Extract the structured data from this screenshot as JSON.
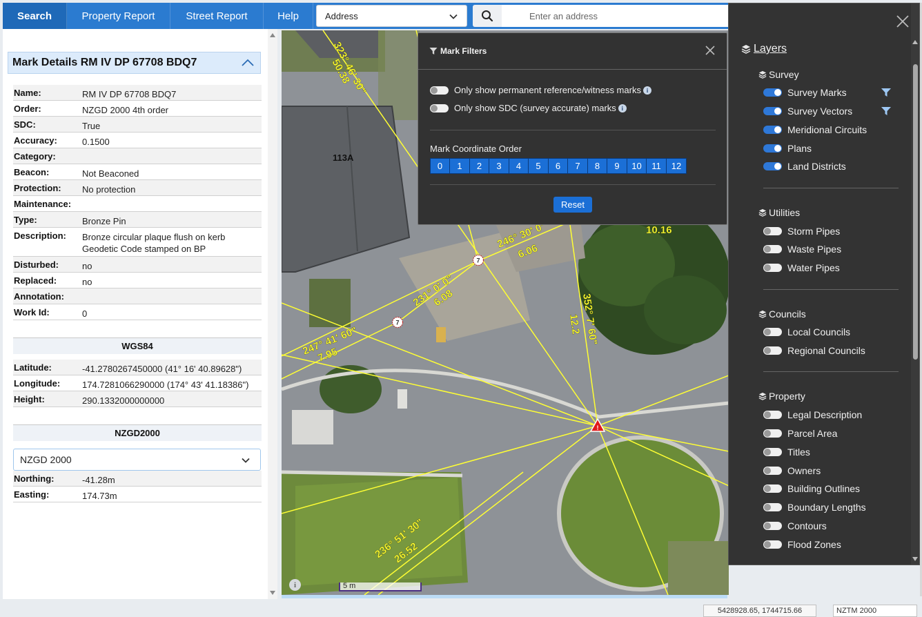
{
  "nav": {
    "search": "Search",
    "property_report": "Property Report",
    "street_report": "Street Report",
    "help": "Help"
  },
  "search": {
    "type_selected": "Address",
    "placeholder": "Enter an address"
  },
  "details": {
    "title": "Mark Details RM IV DP 67708 BDQ7",
    "rows": [
      {
        "label": "Name:",
        "value": "RM IV DP 67708 BDQ7"
      },
      {
        "label": "Order:",
        "value": "NZGD 2000 4th order"
      },
      {
        "label": "SDC:",
        "value": "True"
      },
      {
        "label": "Accuracy:",
        "value": "0.1500"
      },
      {
        "label": "Category:",
        "value": ""
      },
      {
        "label": "Beacon:",
        "value": "Not Beaconed"
      },
      {
        "label": "Protection:",
        "value": "No protection"
      },
      {
        "label": "Maintenance:",
        "value": ""
      },
      {
        "label": "Type:",
        "value": "Bronze Pin"
      },
      {
        "label": "Description:",
        "value": "Bronze circular plaque flush on kerb",
        "value2": "Geodetic Code stamped on BP"
      },
      {
        "label": "Disturbed:",
        "value": "no"
      },
      {
        "label": "Replaced:",
        "value": "no"
      },
      {
        "label": "Annotation:",
        "value": ""
      },
      {
        "label": "Work Id:",
        "value": "0"
      }
    ],
    "wgs84": {
      "heading": "WGS84",
      "rows": [
        {
          "label": "Latitude:",
          "value": "-41.2780267450000 (41° 16' 40.89628\")"
        },
        {
          "label": "Longitude:",
          "value": "174.7281066290000 (174° 43' 41.18386\")"
        },
        {
          "label": "Height:",
          "value": "290.1332000000000"
        }
      ]
    },
    "nzgd2000": {
      "heading": "NZGD2000",
      "datum_selected": "NZGD 2000",
      "rows": [
        {
          "label": "Northing:",
          "value": "-41.28m"
        },
        {
          "label": "Easting:",
          "value": "174.73m"
        }
      ]
    }
  },
  "map": {
    "building_label": "113A",
    "mark_label": "7",
    "scale_label": "5 m",
    "info_glyph": "i",
    "bearings": [
      {
        "angle": "323° 46' 30\"",
        "dist": "50.38"
      },
      {
        "angle": "246° 30' 0\"",
        "dist": "6.06"
      },
      {
        "angle": "231° 0' 0\"",
        "dist": "6.08"
      },
      {
        "angle": "352° 7' 60\"",
        "dist": "12.2"
      },
      {
        "angle": "247° 41' 60\"",
        "dist": "7.95"
      },
      {
        "angle": "236° 51' 30\"",
        "dist": "26.52"
      },
      {
        "angle": "",
        "dist": "10.16"
      }
    ]
  },
  "filters": {
    "title": "Mark Filters",
    "toggles": [
      {
        "label": "Only show permanent reference/witness marks",
        "on": false
      },
      {
        "label": "Only show SDC (survey accurate) marks",
        "on": false
      }
    ],
    "order_label": "Mark Coordinate Order",
    "orders": [
      "0",
      "1",
      "2",
      "3",
      "4",
      "5",
      "6",
      "7",
      "8",
      "9",
      "10",
      "11",
      "12"
    ],
    "reset_label": "Reset"
  },
  "layers": {
    "title": "Layers",
    "groups": [
      {
        "name": "Survey",
        "items": [
          {
            "label": "Survey Marks",
            "on": true,
            "filter": true
          },
          {
            "label": "Survey Vectors",
            "on": true,
            "filter": true
          },
          {
            "label": "Meridional Circuits",
            "on": true
          },
          {
            "label": "Plans",
            "on": true
          },
          {
            "label": "Land Districts",
            "on": true
          }
        ]
      },
      {
        "name": "Utilities",
        "items": [
          {
            "label": "Storm Pipes",
            "on": false
          },
          {
            "label": "Waste Pipes",
            "on": false
          },
          {
            "label": "Water Pipes",
            "on": false
          }
        ]
      },
      {
        "name": "Councils",
        "items": [
          {
            "label": "Local Councils",
            "on": false
          },
          {
            "label": "Regional Councils",
            "on": false
          }
        ]
      },
      {
        "name": "Property",
        "items": [
          {
            "label": "Legal Description",
            "on": false
          },
          {
            "label": "Parcel Area",
            "on": false
          },
          {
            "label": "Titles",
            "on": false
          },
          {
            "label": "Owners",
            "on": false
          },
          {
            "label": "Building Outlines",
            "on": false
          },
          {
            "label": "Boundary Lengths",
            "on": false
          },
          {
            "label": "Contours",
            "on": false
          },
          {
            "label": "Flood Zones",
            "on": false
          }
        ]
      }
    ]
  },
  "status": {
    "coords": "5428928.65, 1744715.66",
    "projection": "NZTM 2000"
  },
  "colors": {
    "nav": "#2b7bd0",
    "accent": "#1b6fd6",
    "panel_dark": "#333333",
    "survey_line": "#ffff33"
  }
}
